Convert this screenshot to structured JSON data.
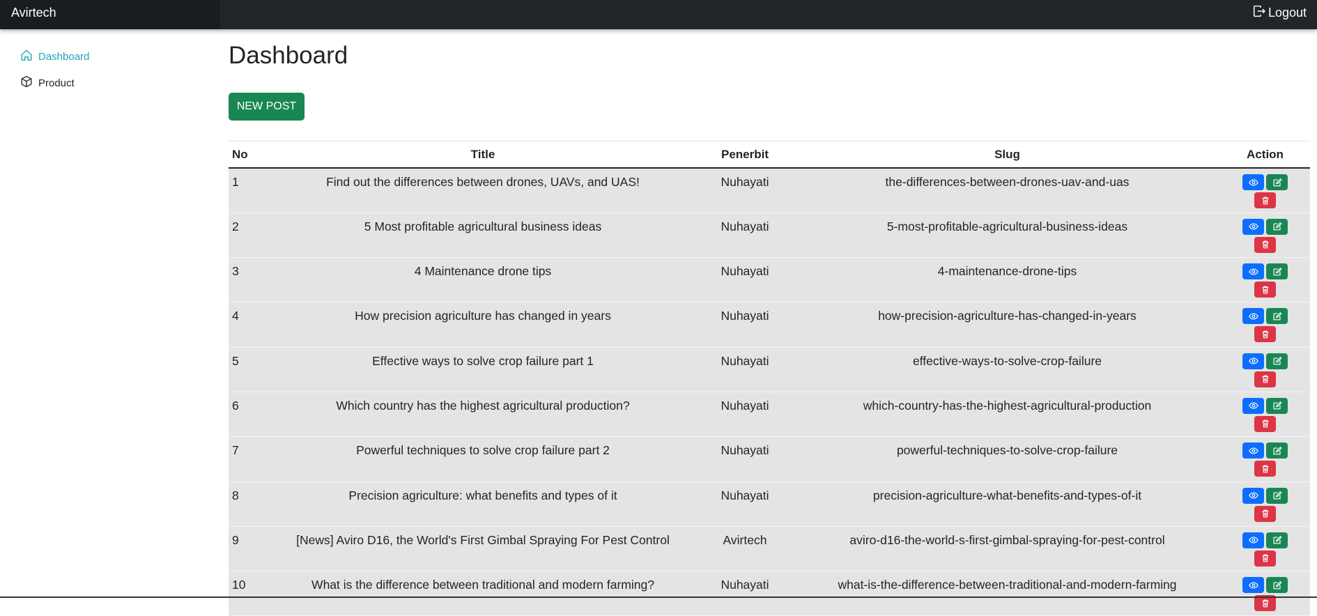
{
  "brand": "Avirtech",
  "header": {
    "logout_label": "Logout"
  },
  "sidebar": {
    "items": [
      {
        "label": "Dashboard",
        "icon": "house-icon",
        "active": true
      },
      {
        "label": "Product",
        "icon": "box-icon",
        "active": false
      }
    ]
  },
  "main": {
    "title": "Dashboard",
    "new_post_label": "NEW POST"
  },
  "table": {
    "headers": {
      "no": "No",
      "title": "Title",
      "penerbit": "Penerbit",
      "slug": "Slug",
      "action": "Action"
    },
    "rows": [
      {
        "no": "1",
        "title": "Find out the differences between drones, UAVs, and UAS!",
        "penerbit": "Nuhayati",
        "slug": "the-differences-between-drones-uav-and-uas"
      },
      {
        "no": "2",
        "title": "5 Most profitable agricultural business ideas",
        "penerbit": "Nuhayati",
        "slug": "5-most-profitable-agricultural-business-ideas"
      },
      {
        "no": "3",
        "title": "4 Maintenance drone tips",
        "penerbit": "Nuhayati",
        "slug": "4-maintenance-drone-tips"
      },
      {
        "no": "4",
        "title": "How precision agriculture has changed in years",
        "penerbit": "Nuhayati",
        "slug": "how-precision-agriculture-has-changed-in-years"
      },
      {
        "no": "5",
        "title": "Effective ways to solve crop failure part 1",
        "penerbit": "Nuhayati",
        "slug": "effective-ways-to-solve-crop-failure"
      },
      {
        "no": "6",
        "title": "Which country has the highest agricultural production?",
        "penerbit": "Nuhayati",
        "slug": "which-country-has-the-highest-agricultural-production"
      },
      {
        "no": "7",
        "title": "Powerful techniques to solve crop failure part 2",
        "penerbit": "Nuhayati",
        "slug": "powerful-techniques-to-solve-crop-failure"
      },
      {
        "no": "8",
        "title": "Precision agriculture: what benefits and types of it",
        "penerbit": "Nuhayati",
        "slug": "precision-agriculture-what-benefits-and-types-of-it"
      },
      {
        "no": "9",
        "title": "[News] Aviro D16, the World's First Gimbal Spraying For Pest Control",
        "penerbit": "Avirtech",
        "slug": "aviro-d16-the-world-s-first-gimbal-spraying-for-pest-control"
      },
      {
        "no": "10",
        "title": "What is the difference between traditional and modern farming?",
        "penerbit": "Nuhayati",
        "slug": "what-is-the-difference-between-traditional-and-modern-farming"
      }
    ]
  },
  "colors": {
    "topbar": "#212529",
    "active": "#1fa2b8",
    "primary": "#0d6efd",
    "success": "#198754",
    "danger": "#dc3545"
  }
}
